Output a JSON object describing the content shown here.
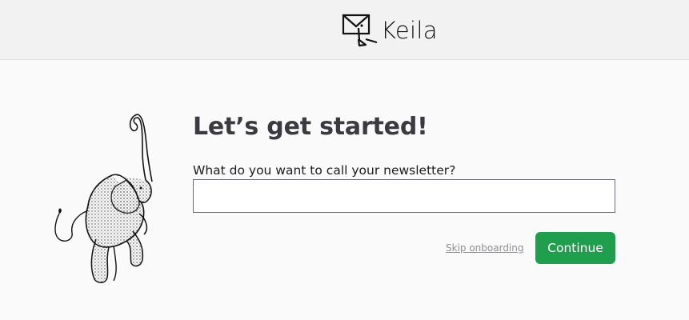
{
  "header": {
    "brand_name": "Keila"
  },
  "onboarding": {
    "title": "Let’s get started!",
    "newsletter_label": "What do you want to call your newsletter?",
    "newsletter_value": "",
    "newsletter_placeholder": "",
    "skip_label": "Skip onboarding",
    "continue_label": "Continue"
  },
  "icons": {
    "logo": "envelope-logo-icon",
    "illustration": "elephant-illustration"
  },
  "colors": {
    "accent": "#1f9e4e",
    "title": "#3a3a40",
    "header_bg": "#f2f2f2",
    "page_bg": "#fafafa"
  }
}
